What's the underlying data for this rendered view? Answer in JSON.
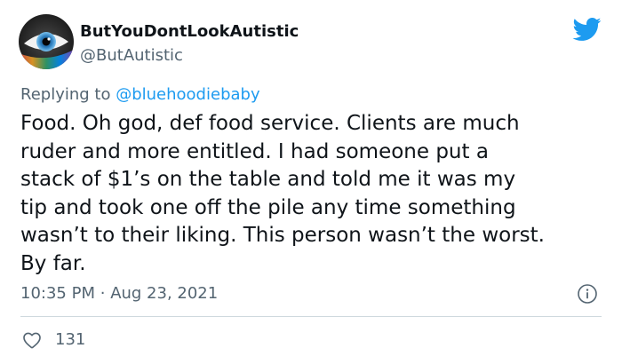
{
  "author": {
    "display_name": "ButYouDontLookAutistic",
    "handle": "@ButAutistic",
    "avatar_icon": "eye-avatar"
  },
  "platform_icon": "twitter-bird-icon",
  "reply": {
    "prefix": "Replying to",
    "mention": "@bluehoodiebaby"
  },
  "tweet": {
    "text": "Food. Oh god, def food service. Clients are much\nruder and more entitled. I had someone put a\nstack of $1’s on the table and told me it was my\ntip and took one off the pile any time something\nwasn’t to their liking. This person wasn’t the worst.\nBy far.",
    "time": "10:35 PM",
    "separator": "·",
    "date": "Aug 23, 2021"
  },
  "actions": {
    "like_count": "131"
  },
  "colors": {
    "accent": "#1d9bf0",
    "secondary_text": "#536471",
    "primary_text": "#0f1419",
    "divider": "#cfd9de"
  }
}
